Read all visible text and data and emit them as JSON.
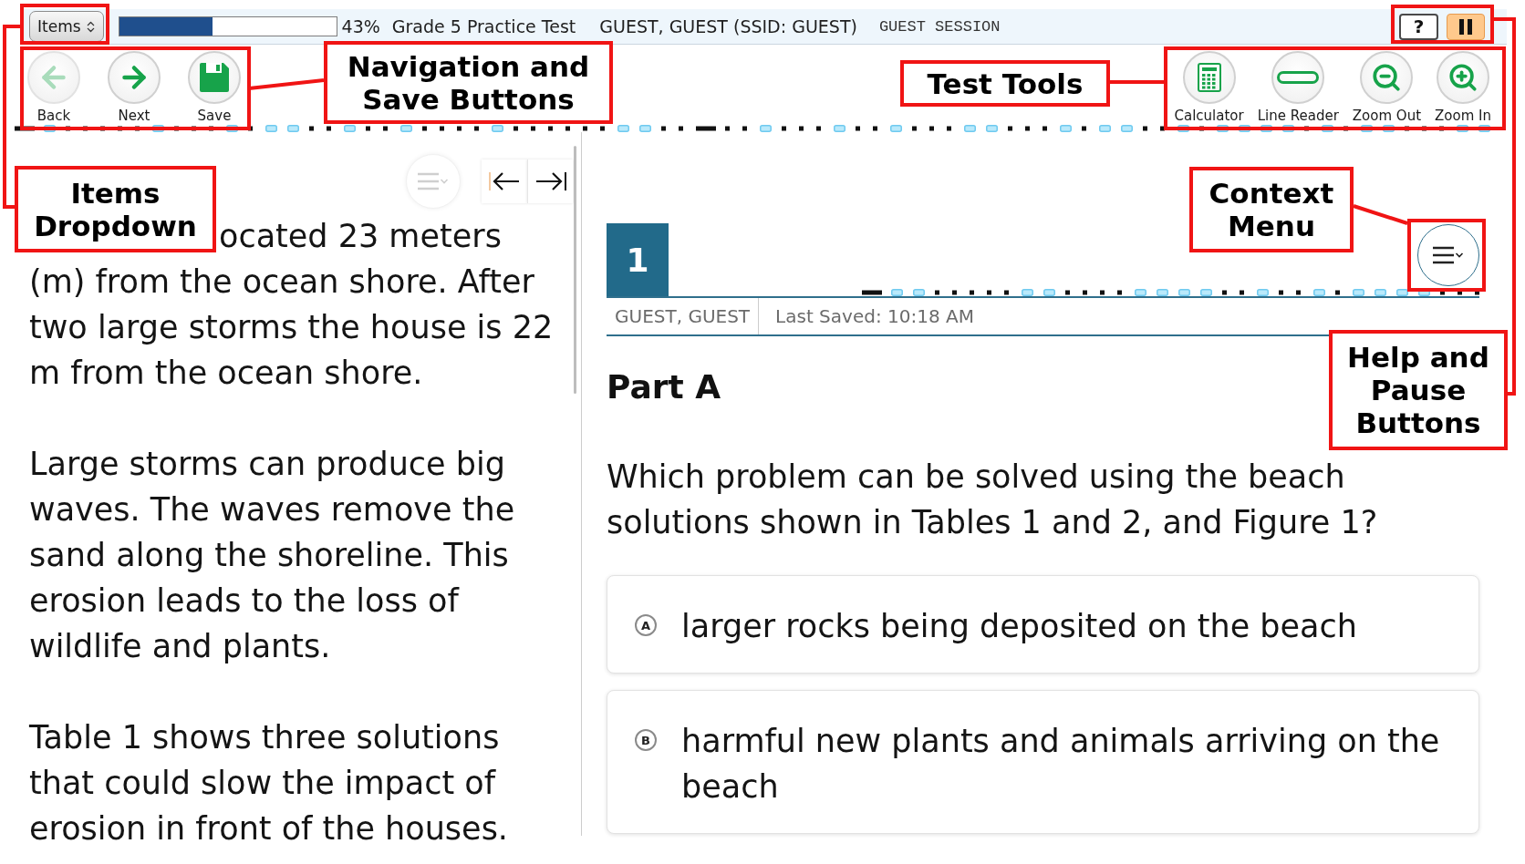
{
  "top_bar": {
    "items_dropdown": "Items",
    "progress": {
      "level": 0.43,
      "reading": "43%"
    },
    "test_name": "Grade 5 Practice Test",
    "student": "GUEST, GUEST (SSID: GUEST)",
    "session": "GUEST SESSION",
    "help_button": "?"
  },
  "nav_buttons": [
    {
      "kind": "back",
      "label": "Back",
      "disabled": true
    },
    {
      "kind": "next",
      "label": "Next",
      "disabled": false
    },
    {
      "kind": "save",
      "label": "Save",
      "disabled": false
    }
  ],
  "tool_buttons": [
    {
      "kind": "calculator",
      "label": "Calculator"
    },
    {
      "kind": "line_reader",
      "label": "Line Reader"
    },
    {
      "kind": "zoom_out",
      "label": "Zoom Out"
    },
    {
      "kind": "zoom_in",
      "label": "Zoom In"
    }
  ],
  "passage": {
    "menu_disabled": true,
    "cut_line": "ocated 23 meters",
    "paragraphs": [
      "(m) from the ocean shore. After two large storms the house is 22 m from the ocean shore.",
      "Large storms can produce big waves. The waves remove the sand along the shoreline. This erosion leads to the loss of wildlife and plants.",
      "Table 1 shows three solutions that could slow the impact of erosion in front of the houses."
    ]
  },
  "item": {
    "number": "1",
    "student": "GUEST, GUEST",
    "last_saved": "Last Saved: 10:18 AM",
    "part": "Part A",
    "question": "Which problem can be solved using the beach solutions shown in Tables 1 and 2, and Figure 1?",
    "options": [
      {
        "letter": "A",
        "text": "larger rocks being deposited on the beach",
        "selected": false
      },
      {
        "letter": "B",
        "text": "harmful new plants and animals arriving on the beach",
        "selected": false
      }
    ]
  },
  "callouts": [
    {
      "text": "Navigation and Save Buttons"
    },
    {
      "text": "Test Tools"
    },
    {
      "text": "Items Dropdown"
    },
    {
      "text": "Context Menu"
    },
    {
      "text": "Help and Pause Buttons"
    }
  ]
}
